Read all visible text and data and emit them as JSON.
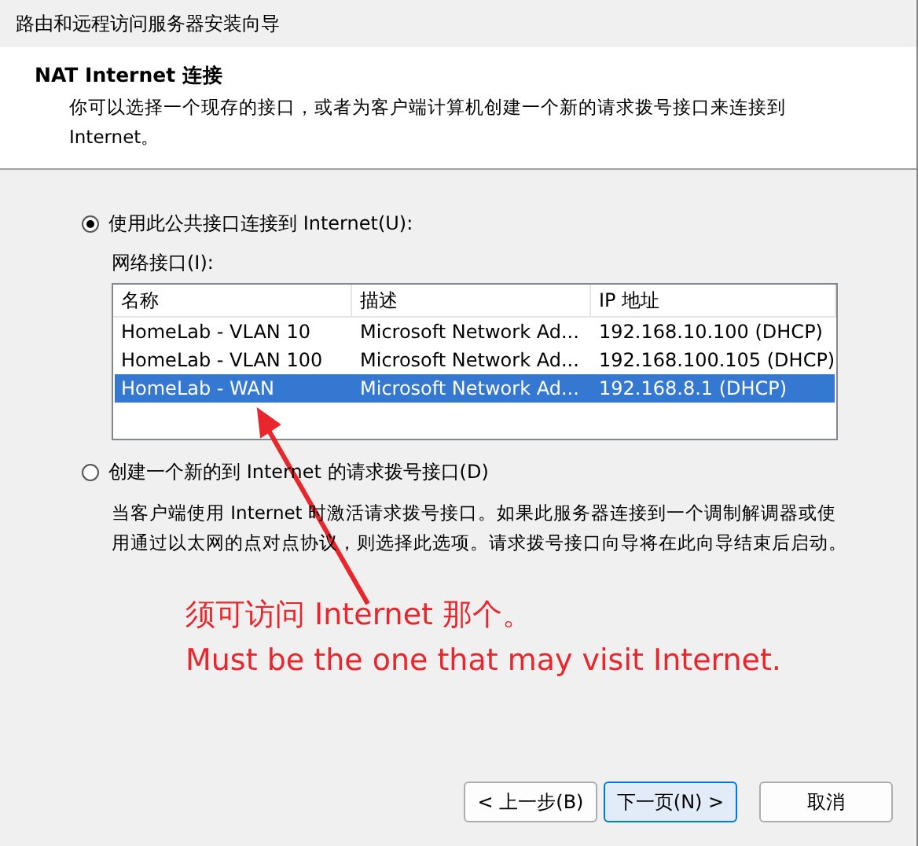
{
  "window": {
    "title": "路由和远程访问服务器安装向导"
  },
  "header": {
    "title": "NAT Internet 连接",
    "description": "你可以选择一个现存的接口，或者为客户端计算机创建一个新的请求拨号接口来连接到 Internet。"
  },
  "options": [
    {
      "label": "使用此公共接口连接到 Internet(U):",
      "selected": true
    },
    {
      "label": "创建一个新的到 Internet 的请求拨号接口(D)",
      "selected": false
    }
  ],
  "list_label": "网络接口(I):",
  "table": {
    "columns": [
      "名称",
      "描述",
      "IP 地址"
    ],
    "rows": [
      {
        "cells": [
          "HomeLab - VLAN 10",
          "Microsoft Network Ad...",
          "192.168.10.100 (DHCP)"
        ],
        "selected": false
      },
      {
        "cells": [
          "HomeLab - VLAN 100",
          "Microsoft Network Ad...",
          "192.168.100.105 (DHCP)"
        ],
        "selected": false
      },
      {
        "cells": [
          "HomeLab - WAN",
          "Microsoft Network Ad...",
          "192.168.8.1 (DHCP)"
        ],
        "selected": true
      }
    ]
  },
  "option_2_description": "当客户端使用 Internet 时激活请求拨号接口。如果此服务器连接到一个调制解调器或使用通过以太网的点对点协议，则选择此选项。请求拨号接口向导将在此向导结束后启动。",
  "annotation": {
    "lines": [
      "须可访问 Internet 那个。",
      "Must be the one that may visit Internet."
    ]
  },
  "buttons": [
    {
      "label": "< 上一步(B)",
      "default": false
    },
    {
      "label": "下一页(N) >",
      "default": true
    },
    {
      "label": "取消",
      "default": false
    }
  ]
}
